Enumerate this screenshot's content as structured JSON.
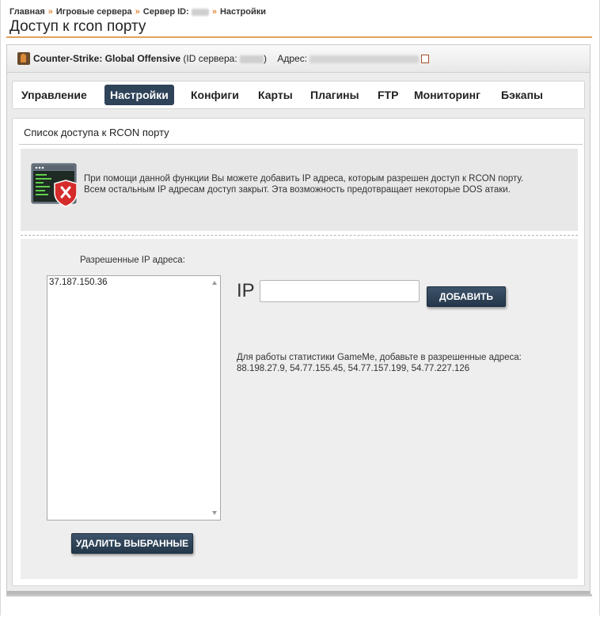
{
  "breadcrumb": {
    "home": "Главная",
    "servers": "Игровые сервера",
    "server_id": "Сервер ID:",
    "settings": "Настройки"
  },
  "page_title": "Доступ к rcon порту",
  "server": {
    "game": "Counter-Strike: Global Offensive",
    "id_label": "(ID сервера:",
    "id_close": ")",
    "address_label": "Адрес:"
  },
  "nav": {
    "tabs": [
      {
        "label": "Управление",
        "active": false
      },
      {
        "label": "Настройки",
        "active": true
      },
      {
        "label": "Конфиги",
        "active": false
      },
      {
        "label": "Карты",
        "active": false
      },
      {
        "label": "Плагины",
        "active": false
      },
      {
        "label": "FTP",
        "active": false
      },
      {
        "label": "Мониторинг",
        "active": false
      },
      {
        "label": "Бэкапы",
        "active": false
      }
    ]
  },
  "section": {
    "title": "Список доступа к RCON порту",
    "info_line1": "При помощи данной функции Вы можете добавить IP адреса, которым разрешен доступ к RCON порту.",
    "info_line2": "Всем остальным IP адресам доступ закрыт. Эта возможность предотвращает некоторые DOS атаки."
  },
  "allowed": {
    "label": "Разрешенные IP адреса:",
    "items": [
      "37.187.150.36"
    ],
    "delete_button": "УДАЛИТЬ ВЫБРАННЫЕ"
  },
  "add_form": {
    "ip_prefix": "IP",
    "input_value": "",
    "add_button": "ДОБАВИТЬ"
  },
  "gameme": {
    "line1": "Для работы статистики GameMe, добавьте в разрешенные адреса:",
    "line2": "88.198.27.9, 54.77.155.45, 54.77.157.199, 54.77.227.126"
  },
  "colors": {
    "accent_orange": "#e3a15a",
    "tab_active_bg": "#2f4359",
    "button_bg": "#2f4359"
  }
}
